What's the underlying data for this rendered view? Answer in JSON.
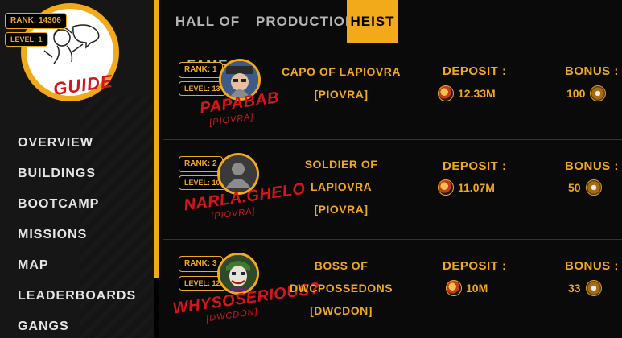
{
  "sidebar": {
    "rank": "RANK: 14306",
    "level": "LEVEL: 1",
    "guide_label": "GUIDE",
    "nav": [
      "OVERVIEW",
      "BUILDINGS",
      "BOOTCAMP",
      "MISSIONS",
      "MAP",
      "LEADERBOARDS",
      "GANGS"
    ]
  },
  "tabs": [
    {
      "label": "HALL OF FAME",
      "active": false
    },
    {
      "label": "PRODUCTION",
      "active": false
    },
    {
      "label": "HEIST",
      "active": true
    }
  ],
  "rows": [
    {
      "rank": "RANK: 1",
      "level": "LEVEL: 13",
      "name": "PAPABAB",
      "tag": "[PIOVRA]",
      "role_lines": [
        "CAPO OF LAPIOVRA",
        "[PIOVRA]"
      ],
      "deposit_label": "DEPOSIT :",
      "deposit": "12.33M",
      "bonus_label": "BONUS :",
      "bonus": "100",
      "avatar": "portrait-man-hat-icon"
    },
    {
      "rank": "RANK: 2",
      "level": "LEVEL: 10",
      "name": "NARLA.GHELO",
      "tag": "[PIOVRA]",
      "role_lines": [
        "SOLDIER OF",
        "LAPIOVRA",
        "[PIOVRA]"
      ],
      "deposit_label": "DEPOSIT :",
      "deposit": "11.07M",
      "bonus_label": "BONUS :",
      "bonus": "50",
      "avatar": "default-user-icon"
    },
    {
      "rank": "RANK: 3",
      "level": "LEVEL: 12",
      "name": "WHYSOSERIOUS?",
      "tag": "[DWCDON]",
      "role_lines": [
        "BOSS OF",
        "DWCPOSSEDONS",
        "[DWCDON]"
      ],
      "deposit_label": "DEPOSIT :",
      "deposit": "10M",
      "bonus_label": "BONUS :",
      "bonus": "33",
      "avatar": "joker-portrait-icon"
    }
  ],
  "colors": {
    "accent": "#f2a91a",
    "name_red": "#d6141b",
    "background": "#0a0a0a",
    "sidebar": "#161616"
  }
}
